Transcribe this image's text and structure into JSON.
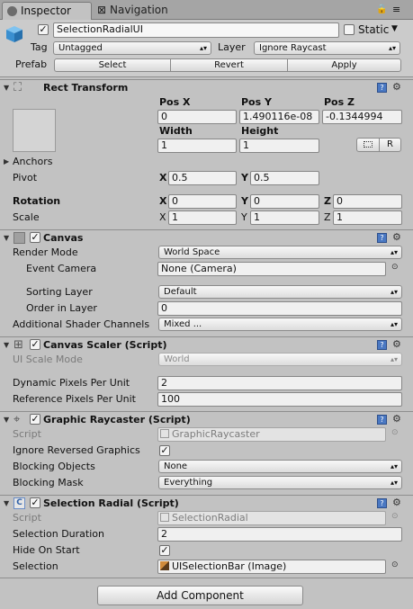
{
  "tabs": {
    "inspector": "Inspector",
    "navigation": "Navigation"
  },
  "header": {
    "object_name": "SelectionRadialUI",
    "static_label": "Static",
    "tag_label": "Tag",
    "tag_value": "Untagged",
    "layer_label": "Layer",
    "layer_value": "Ignore Raycast",
    "prefab_label": "Prefab",
    "select_btn": "Select",
    "revert_btn": "Revert",
    "apply_btn": "Apply"
  },
  "rect_transform": {
    "title": "Rect Transform",
    "pos_x_label": "Pos X",
    "pos_y_label": "Pos Y",
    "pos_z_label": "Pos Z",
    "pos_x": "0",
    "pos_y": "1.490116e-08",
    "pos_z": "-0.1344994",
    "width_label": "Width",
    "height_label": "Height",
    "width": "1",
    "height": "1",
    "r_btn": "R",
    "anchors_label": "Anchors",
    "pivot_label": "Pivot",
    "pivot_x": "0.5",
    "pivot_y": "0.5",
    "rotation_label": "Rotation",
    "rot_x": "0",
    "rot_y": "0",
    "rot_z": "0",
    "scale_label": "Scale",
    "scale_x": "1",
    "scale_y": "1",
    "scale_z": "1",
    "x": "X",
    "y": "Y",
    "z": "Z"
  },
  "canvas": {
    "title": "Canvas",
    "render_mode_label": "Render Mode",
    "render_mode": "World Space",
    "event_camera_label": "Event Camera",
    "event_camera": "None (Camera)",
    "sorting_layer_label": "Sorting Layer",
    "sorting_layer": "Default",
    "order_label": "Order in Layer",
    "order": "0",
    "shader_channels_label": "Additional Shader Channels",
    "shader_channels": "Mixed ..."
  },
  "canvas_scaler": {
    "title": "Canvas Scaler (Script)",
    "scale_mode_label": "UI Scale Mode",
    "scale_mode": "World",
    "dynamic_label": "Dynamic Pixels Per Unit",
    "dynamic": "2",
    "reference_label": "Reference Pixels Per Unit",
    "reference": "100"
  },
  "graphic_raycaster": {
    "title": "Graphic Raycaster (Script)",
    "script_label": "Script",
    "script": "GraphicRaycaster",
    "ignore_label": "Ignore Reversed Graphics",
    "blocking_objects_label": "Blocking Objects",
    "blocking_objects": "None",
    "blocking_mask_label": "Blocking Mask",
    "blocking_mask": "Everything"
  },
  "selection_radial": {
    "title": "Selection Radial (Script)",
    "script_label": "Script",
    "script": "SelectionRadial",
    "duration_label": "Selection Duration",
    "duration": "2",
    "hide_label": "Hide On Start",
    "selection_label": "Selection",
    "selection": "UISelectionBar (Image)"
  },
  "add_component": "Add Component",
  "icons": [
    "inspector-icon",
    "navigation-icon",
    "lock-icon",
    "menu-icon",
    "cube-icon",
    "rect-transform-icon",
    "canvas-icon",
    "canvas-scaler-icon",
    "raycaster-icon",
    "script-icon",
    "help-icon",
    "gear-icon",
    "object-picker-icon"
  ],
  "colors": {
    "panel": "#c2c2c2",
    "help_blue": "#4a78c2"
  }
}
